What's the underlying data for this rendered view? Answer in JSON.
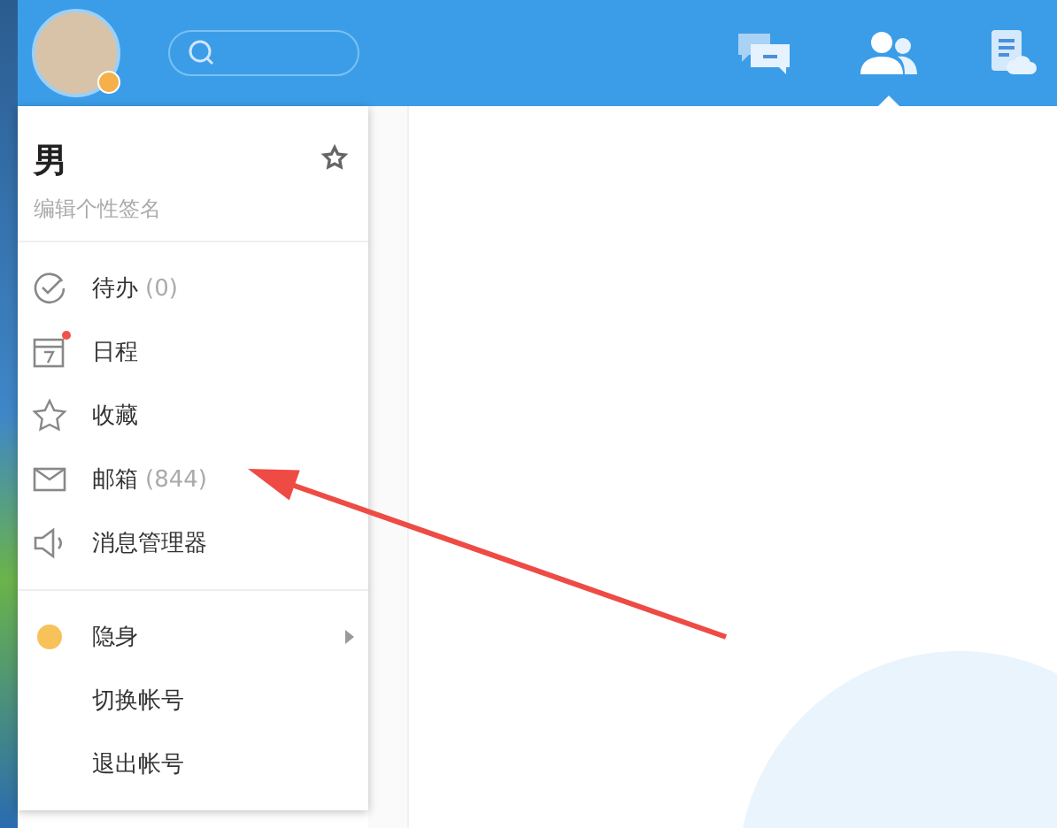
{
  "header": {
    "tabs": [
      {
        "kind": "messages",
        "selected": false
      },
      {
        "kind": "contacts",
        "selected": true
      },
      {
        "kind": "files",
        "selected": false
      }
    ]
  },
  "menu": {
    "profile": {
      "name": "男",
      "signature": "编辑个性签名"
    },
    "items": [
      {
        "kind": "todo",
        "label": "待办",
        "count": "(0)",
        "badge": false
      },
      {
        "kind": "calendar",
        "label": "日程",
        "badge": true
      },
      {
        "kind": "favorites",
        "label": "收藏",
        "badge": false
      },
      {
        "kind": "mail",
        "label": "邮箱",
        "count": "(844)",
        "badge": false
      },
      {
        "kind": "messages",
        "label": "消息管理器",
        "badge": false
      }
    ],
    "status": {
      "label": "隐身",
      "has_submenu": true
    },
    "actions": [
      {
        "label": "切换帐号"
      },
      {
        "label": "退出帐号"
      }
    ]
  }
}
